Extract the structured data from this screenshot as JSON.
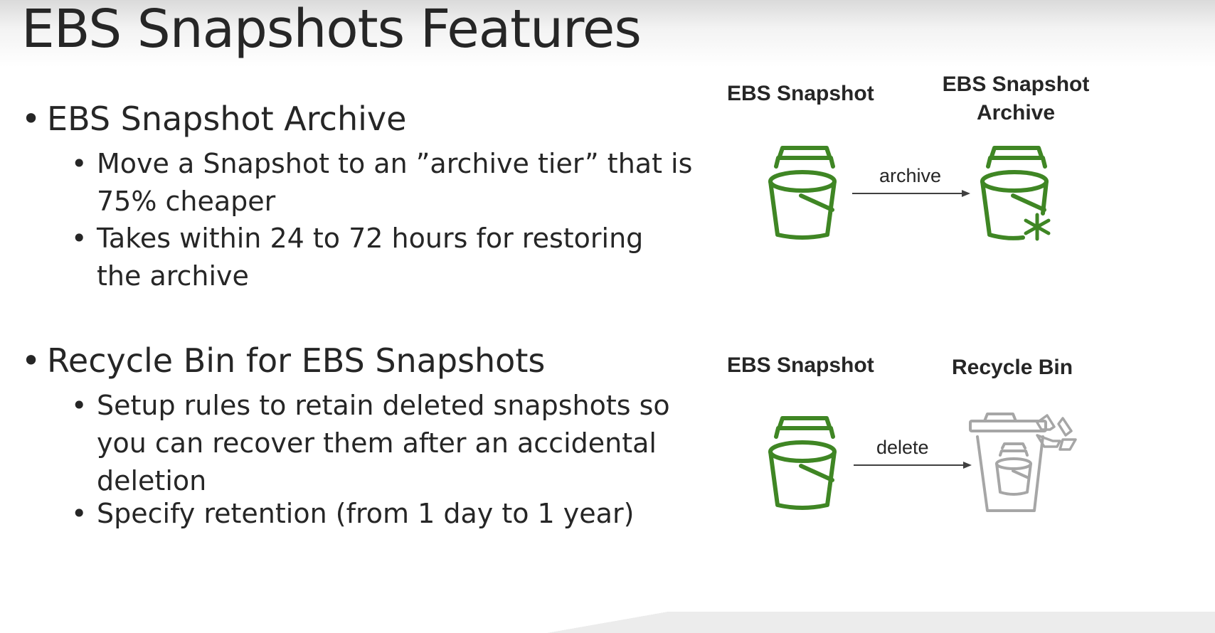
{
  "slide": {
    "title": "EBS Snapshots Features",
    "sections": [
      {
        "heading": "EBS Snapshot Archive",
        "points": [
          [
            "Move a Snapshot to an ”archive tier” that is",
            "75% cheaper"
          ],
          [
            "Takes within 24 to 72 hours for restoring",
            "the archive"
          ]
        ]
      },
      {
        "heading": "Recycle Bin for EBS Snapshots",
        "points": [
          [
            "Setup rules to retain deleted snapshots so",
            "you can recover them after an accidental",
            "deletion"
          ],
          [
            "Specify retention (from 1 day to 1 year)"
          ]
        ]
      }
    ]
  },
  "diagram": {
    "archive_flow": {
      "source_label": "EBS Snapshot",
      "target_label_line1": "EBS Snapshot",
      "target_label_line2": "Archive",
      "arrow_label": "archive",
      "source_icon": "bucket-icon",
      "target_icon": "bucket-snowflake-icon"
    },
    "recycle_flow": {
      "source_label": "EBS Snapshot",
      "target_label": "Recycle Bin",
      "arrow_label": "delete",
      "source_icon": "bucket-icon",
      "target_icon": "recycle-bin-icon"
    }
  },
  "colors": {
    "aws_green": "#3f8624",
    "text": "#262626",
    "bin_gray": "#a6a6a6"
  }
}
